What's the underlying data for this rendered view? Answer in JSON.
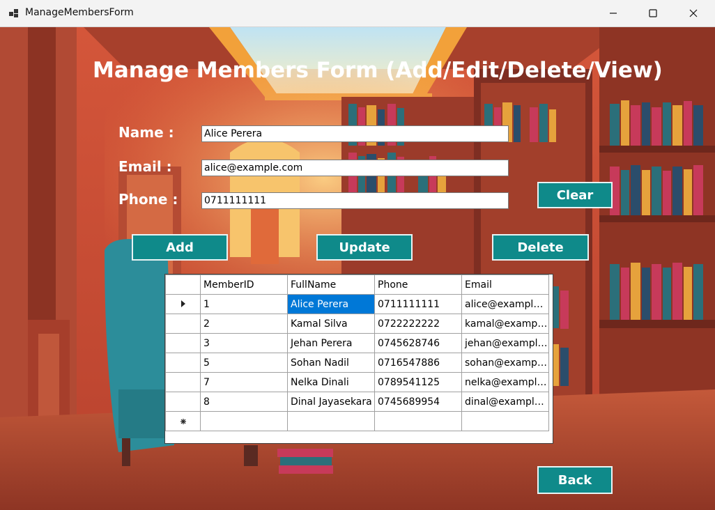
{
  "window": {
    "title": "ManageMembersForm",
    "minimize_icon": "minimize-icon",
    "maximize_icon": "maximize-icon",
    "close_icon": "close-icon"
  },
  "form": {
    "heading": "Manage Members Form (Add/Edit/Delete/View)",
    "name_label": "Name :",
    "email_label": "Email :",
    "phone_label": "Phone :",
    "name_value": "Alice Perera",
    "email_value": "alice@example.com",
    "phone_value": "0711111111"
  },
  "buttons": {
    "clear": "Clear",
    "add": "Add",
    "update": "Update",
    "delete": "Delete",
    "back": "Back"
  },
  "colors": {
    "button_bg": "#0f8a8a",
    "selection": "#0078d7"
  },
  "grid": {
    "columns": [
      "MemberID",
      "FullName",
      "Phone",
      "Email"
    ],
    "rows": [
      [
        "1",
        "Alice Perera",
        "0711111111",
        "alice@example.com"
      ],
      [
        "2",
        "Kamal Silva",
        "0722222222",
        "kamal@example.com"
      ],
      [
        "3",
        "Jehan Perera",
        "0745628746",
        "jehan@example.com"
      ],
      [
        "5",
        "Sohan Nadil",
        "0716547886",
        "sohan@example.com"
      ],
      [
        "7",
        "Nelka Dinali",
        "0789541125",
        "nelka@example.com"
      ],
      [
        "8",
        "Dinal Jayasekara",
        "0745689954",
        "dinal@example.com"
      ]
    ],
    "current_row_icon": "row-pointer-icon",
    "new_row_icon": "new-row-asterisk-icon"
  }
}
